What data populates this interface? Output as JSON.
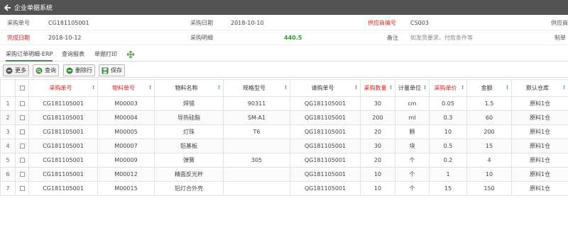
{
  "app": {
    "title": "企业单据系统"
  },
  "form": {
    "purchase_no_label": "采购单号",
    "purchase_no": "CG181105001",
    "purchase_date_label": "采购日期",
    "purchase_date": "2018-10-10",
    "supplier_code_label": "供应商编号",
    "supplier_code": "CS003",
    "supplier_trunc_label": "供应商",
    "complete_date_label": "完成日期",
    "complete_date": "2018-10-12",
    "purchase_detail_label": "采购明细",
    "purchase_total": "440.5",
    "remark_label": "备注",
    "remark_value": "如发货要求、付款条件等",
    "maker_trunc_label": "制单"
  },
  "tabs": [
    {
      "label": "采购订单明细-ERP"
    },
    {
      "label": "查询报表"
    },
    {
      "label": "单据打印"
    }
  ],
  "toolbar": {
    "more": "更多",
    "query": "查询",
    "delete_row": "删除行",
    "save": "保存"
  },
  "table": {
    "columns": [
      "",
      "",
      "采购单号",
      "物料单号",
      "物料名称",
      "规格型号",
      "请购单号",
      "采购数量",
      "计量单位",
      "采购单价",
      "金额",
      "默认仓库"
    ],
    "rows": [
      [
        "1",
        "CG181105001",
        "M00003",
        "焊锡",
        "90311",
        "QG181105001",
        "30",
        "cm",
        "0.05",
        "1.5",
        "原料1仓"
      ],
      [
        "2",
        "CG181105001",
        "M00004",
        "导热硅脂",
        "SM-A1",
        "QG181105001",
        "200",
        "ml",
        "0.3",
        "60",
        "原料1仓"
      ],
      [
        "3",
        "CG181105001",
        "M00005",
        "灯珠",
        "T6",
        "QG181105001",
        "20",
        "颗",
        "10",
        "200",
        "原料1仓"
      ],
      [
        "4",
        "CG181105001",
        "M00007",
        "铝基板",
        "",
        "QG181105001",
        "30",
        "块",
        "0.5",
        "15",
        "原料1仓"
      ],
      [
        "5",
        "CG181105001",
        "M00009",
        "弹簧",
        "305",
        "QG181105001",
        "20",
        "个",
        "0.2",
        "4",
        "原料1仓"
      ],
      [
        "6",
        "CG181105001",
        "M00012",
        "精面反光杯",
        "",
        "QG181105001",
        "10",
        "个",
        "1",
        "10",
        "原料1仓"
      ],
      [
        "7",
        "CG181105001",
        "M00015",
        "铝灯合外壳",
        "",
        "QG181105001",
        "10",
        "个",
        "15",
        "150",
        "原料1仓"
      ]
    ]
  },
  "icons": {
    "back": "arrow-left-icon",
    "more": "minus-circle-icon",
    "query": "search-icon",
    "delete_row": "minus-circle-icon",
    "save": "save-icon",
    "tab_more": "move-icon"
  },
  "colors": {
    "titlebar": "#525252",
    "required": "#e02020",
    "total": "#2a9a2a",
    "accent_green": "#4a9a4a"
  }
}
